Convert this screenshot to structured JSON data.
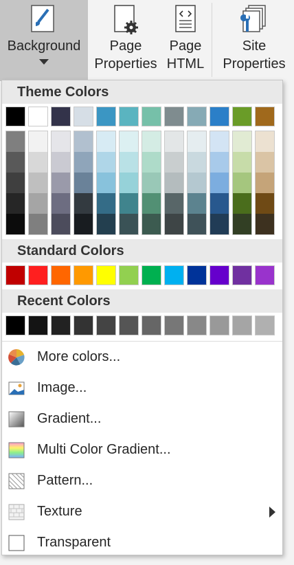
{
  "ribbon": {
    "background_label": "Background",
    "page_properties_label_1": "Page",
    "page_properties_label_2": "Properties",
    "page_html_label_1": "Page",
    "page_html_label_2": "HTML",
    "site_properties_label_1": "Site",
    "site_properties_label_2": "Properties"
  },
  "menu": {
    "theme_header": "Theme Colors",
    "standard_header": "Standard Colors",
    "recent_header": "Recent Colors",
    "theme_top": [
      "#000000",
      "#ffffff",
      "#33334a",
      "#d6dee6",
      "#3b96c3",
      "#5ab4c0",
      "#76c0a9",
      "#7f8c8f",
      "#86aab5",
      "#2b7fc8",
      "#6a9c28",
      "#a0691c"
    ],
    "theme_columns": [
      [
        "#7f7f7f",
        "#595959",
        "#3f3f3f",
        "#262626",
        "#0c0c0c"
      ],
      [
        "#f2f2f2",
        "#d8d8d8",
        "#bfbfbf",
        "#a5a5a5",
        "#7f7f7f"
      ],
      [
        "#e5e5e9",
        "#cacad2",
        "#9a9aaa",
        "#6d6d81",
        "#4c4c5c"
      ],
      [
        "#b1c0cf",
        "#8fa5ba",
        "#6a8299",
        "#333a40",
        "#181c20"
      ],
      [
        "#d7ebf4",
        "#afd6e8",
        "#88c2dc",
        "#346c87",
        "#233f4f"
      ],
      [
        "#dcf0f2",
        "#b9e1e6",
        "#96d2d9",
        "#40848d",
        "#3a5256"
      ],
      [
        "#d4ece4",
        "#aedbc9",
        "#99c8b7",
        "#529074",
        "#3c5b50"
      ],
      [
        "#e3e6e7",
        "#c9cecf",
        "#b4bcbe",
        "#586668",
        "#3e4546"
      ],
      [
        "#e5edf0",
        "#c9d9df",
        "#b4c8d0",
        "#5c838f",
        "#3f5259"
      ],
      [
        "#d3e4f4",
        "#a8caea",
        "#7caddf",
        "#28588e",
        "#213c56"
      ],
      [
        "#e1ebd3",
        "#c7dca9",
        "#a5c67e",
        "#4a6d1c",
        "#323f24"
      ],
      [
        "#ece1d1",
        "#dac4a5",
        "#c5a479",
        "#6f4a15",
        "#3d311f"
      ]
    ],
    "standard": [
      "#c00000",
      "#ff1f1f",
      "#ff6600",
      "#ff9900",
      "#ffff00",
      "#92d050",
      "#00b050",
      "#00b0f0",
      "#003399",
      "#6600cc",
      "#7030a0",
      "#9933cc"
    ],
    "recent": [
      "#000000",
      "#141414",
      "#222222",
      "#333333",
      "#444444",
      "#555555",
      "#666666",
      "#777777",
      "#888888",
      "#999999",
      "#a5a5a5",
      "#b0b0b0"
    ],
    "more_colors": "More colors...",
    "image": "Image...",
    "gradient": "Gradient...",
    "multi_gradient": "Multi Color Gradient...",
    "pattern": "Pattern...",
    "texture": "Texture",
    "transparent": "Transparent"
  }
}
